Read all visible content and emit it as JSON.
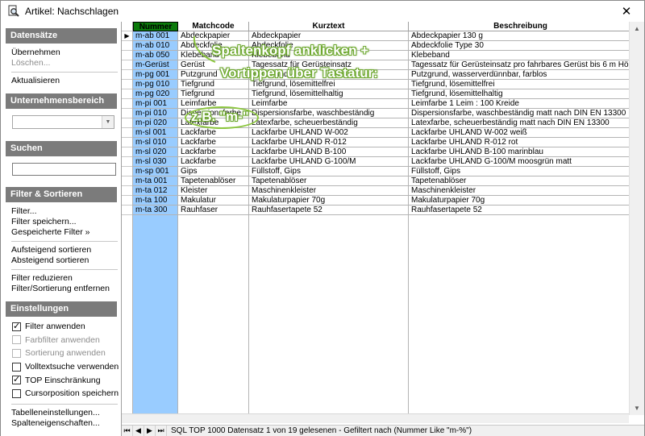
{
  "window": {
    "title": "Artikel: Nachschlagen",
    "close_glyph": "✕",
    "icon": "magnifier-document-icon"
  },
  "sidebar": {
    "datensaetze": {
      "heading": "Datensätze",
      "uebernehmen": "Übernehmen",
      "loeschen": "Löschen...",
      "aktualisieren": "Aktualisieren"
    },
    "unternehmensbereich": {
      "heading": "Unternehmensbereich",
      "selected": ""
    },
    "suchen": {
      "heading": "Suchen",
      "value": ""
    },
    "filter": {
      "heading": "Filter & Sortieren",
      "filter": "Filter...",
      "filter_speichern": "Filter speichern...",
      "gespeicherte_filter": "Gespeicherte Filter »",
      "aufsteigend": "Aufsteigend sortieren",
      "absteigend": "Absteigend sortieren",
      "filter_reduzieren": "Filter reduzieren",
      "entfernen": "Filter/Sortierung entfernen"
    },
    "einstellungen": {
      "heading": "Einstellungen",
      "options": [
        {
          "label": "Filter anwenden",
          "checked": true,
          "enabled": true
        },
        {
          "label": "Farbfilter anwenden",
          "checked": false,
          "enabled": false
        },
        {
          "label": "Sortierung anwenden",
          "checked": false,
          "enabled": false
        },
        {
          "label": "Volltextsuche verwenden",
          "checked": false,
          "enabled": true
        },
        {
          "label": "TOP Einschränkung",
          "checked": true,
          "enabled": true
        },
        {
          "label": "Cursorposition speichern",
          "checked": false,
          "enabled": true
        }
      ],
      "tabelleneinstellungen": "Tabelleneinstellungen...",
      "spalteneigenschaften": "Spalteneigenschaften..."
    }
  },
  "grid": {
    "columns": [
      "Nummer",
      "Matchcode",
      "Kurztext",
      "Beschreibung"
    ],
    "rows": [
      [
        "m-ab 001",
        "Abdeckpapier",
        "Abdeckpapier",
        "Abdeckpapier 130 g"
      ],
      [
        "m-ab 010",
        "Abdeckfolie",
        "Abdeckfolie",
        "Abdeckfolie Type 30"
      ],
      [
        "m-ab 050",
        "Klebeband",
        "Klebeband",
        "Klebeband"
      ],
      [
        "m-Gerüst",
        "Gerüst",
        "Tagessatz für Gerüsteinsatz",
        "Tagessatz für Gerüsteinsatz pro fahrbares Gerüst bis 6 m Höhe"
      ],
      [
        "m-pg 001",
        "Putzgrund",
        "Putzgrund",
        "Putzgrund, wasserverdünnbar, farblos"
      ],
      [
        "m-pg 010",
        "Tiefgrund",
        "Tiefgrund, lösemittelfrei",
        "Tiefgrund, lösemittelfrei"
      ],
      [
        "m-pg 020",
        "Tiefgrund",
        "Tiefgrund, lösemittelhaltig",
        "Tiefgrund, lösemittelhaltig"
      ],
      [
        "m-pi 001",
        "Leimfarbe",
        "Leimfarbe",
        "Leimfarbe 1 Leim : 100 Kreide"
      ],
      [
        "m-pi 010",
        "Dispersionsfarbe",
        "Dispersionsfarbe, waschbeständig",
        "Dispersionsfarbe, waschbeständig matt nach DIN EN 13300"
      ],
      [
        "m-pi 020",
        "Latexfarbe",
        "Latexfarbe, scheuerbeständig",
        "Latexfarbe, scheuerbeständig matt nach DIN EN 13300"
      ],
      [
        "m-sl 001",
        "Lackfarbe",
        "Lackfarbe UHLAND W-002",
        "Lackfarbe UHLAND W-002 weiß"
      ],
      [
        "m-sl 010",
        "Lackfarbe",
        "Lackfarbe UHLAND R-012",
        "Lackfarbe UHLAND R-012 rot"
      ],
      [
        "m-sl 020",
        "Lackfarbe",
        "Lackfarbe UHLAND B-100",
        "Lackfarbe UHLAND B-100 marinblau"
      ],
      [
        "m-sl 030",
        "Lackfarbe",
        "Lackfarbe UHLAND G-100/M",
        "Lackfarbe UHLAND G-100/M moosgrün matt"
      ],
      [
        "m-sp 001",
        "Gips",
        "Füllstoff, Gips",
        "Füllstoff, Gips"
      ],
      [
        "m-ta 001",
        "Tapetenablöser",
        "Tapetenablöser",
        "Tapetenablöser"
      ],
      [
        "m-ta 012",
        "Kleister",
        "Maschinenkleister",
        "Maschinenkleister"
      ],
      [
        "m-ta 100",
        "Makulatur",
        "Makulaturpapier 70g",
        "Makulaturpapier 70g"
      ],
      [
        "m-ta 300",
        "Rauhfaser",
        "Rauhfasertapete 52",
        "Rauhfasertapete 52"
      ]
    ],
    "current_row_indicator": "▶"
  },
  "annotation": {
    "line1": "Spaltenkopf anklicken +",
    "line2": "Vortippen über Tastatur:",
    "line3": "z.B. \"m-\"",
    "color": "#8cc63f"
  },
  "statusbar": {
    "first": "⏮",
    "prev": "◀",
    "next": "▶",
    "last": "⏭",
    "text": "SQL TOP 1000 Datensatz 1 von 19 gelesenen - Gefiltert nach (Nummer Like \"m-%\")"
  }
}
